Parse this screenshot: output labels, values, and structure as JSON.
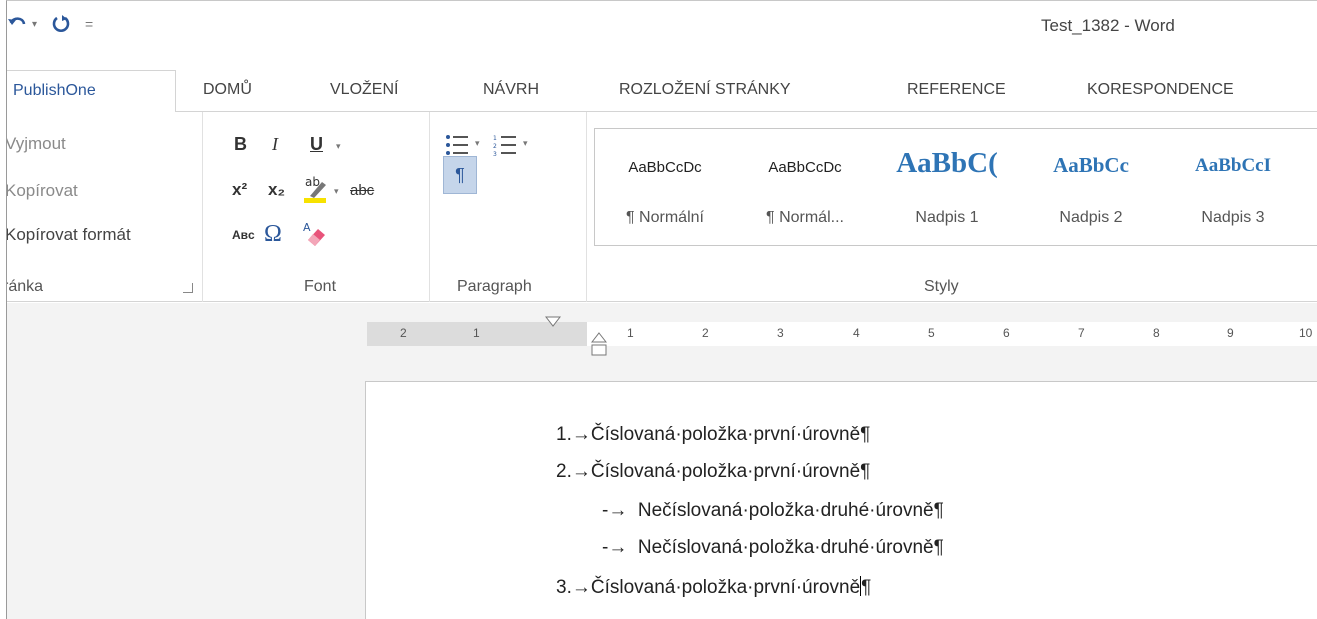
{
  "window": {
    "title": "Test_1382 - Word"
  },
  "quick_access": {
    "undo_icon": "undo-icon",
    "redo_icon": "redo-icon",
    "customize_symbol": "="
  },
  "tabs": [
    {
      "label": "PublishOne",
      "active": true
    },
    {
      "label": "DOMŮ"
    },
    {
      "label": "VLOŽENÍ"
    },
    {
      "label": "NÁVRH"
    },
    {
      "label": "ROZLOŽENÍ STRÁNKY"
    },
    {
      "label": "REFERENCE"
    },
    {
      "label": "KORESPONDENCE"
    }
  ],
  "clipboard": {
    "cut": "Vyjmout",
    "copy": "Kopírovat",
    "format_painter": "Kopírovat formát",
    "group_label": "ránka"
  },
  "font_group": {
    "bold": "B",
    "italic": "I",
    "underline": "U",
    "superscript": "x²",
    "subscript": "x₂",
    "highlight": "ab",
    "strikethrough": "abc",
    "change_case": "Aвc",
    "symbol": "Ω",
    "group_label": "Font"
  },
  "paragraph_group": {
    "pilcrow": "¶",
    "group_label": "Paragraph"
  },
  "styles_group": {
    "group_label": "Styly",
    "items": [
      {
        "sample": "AaBbCcDc",
        "name": "¶ Normální"
      },
      {
        "sample": "AaBbCcDc",
        "name": "¶ Normál..."
      },
      {
        "sample": "AaBbC(",
        "name": "Nadpis 1"
      },
      {
        "sample": "AaBbCc",
        "name": "Nadpis 2"
      },
      {
        "sample": "AaBbCcI",
        "name": "Nadpis 3"
      }
    ]
  },
  "ruler": {
    "ticks": [
      "2",
      "1",
      "1",
      "2",
      "3",
      "4",
      "5",
      "6",
      "7",
      "8",
      "9",
      "10"
    ]
  },
  "document": {
    "lines": [
      {
        "marker": "1.→",
        "text": "Číslovaná·položka·první·úrovně",
        "pm": "¶"
      },
      {
        "marker": "2.→",
        "text": "Číslovaná·položka·první·úrovně",
        "pm": "¶"
      },
      {
        "marker": "-→",
        "text": "Nečíslovaná·položka·druhé·úrovně",
        "pm": "¶"
      },
      {
        "marker": "-→",
        "text": "Nečíslovaná·položka·druhé·úrovně",
        "pm": "¶"
      },
      {
        "marker": "3.→",
        "text": "Číslovaná·položka·první·úrovně",
        "pm": "¶"
      }
    ]
  }
}
